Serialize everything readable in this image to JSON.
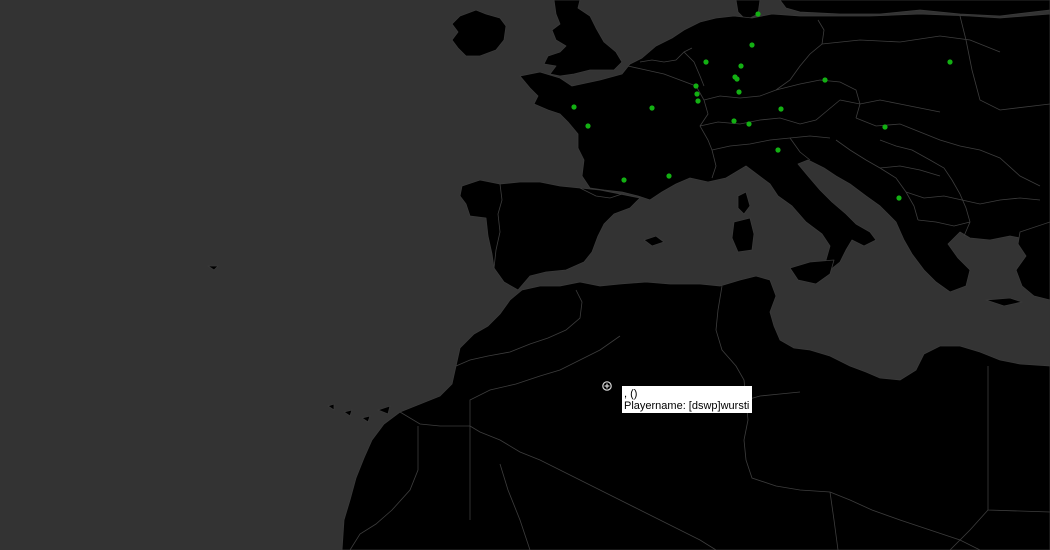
{
  "map": {
    "ocean_color": "#333333",
    "land_color": "#000000",
    "border_color": "#3d3d3d",
    "player_marker_color": "#13b013",
    "cursor": "crosshair-plus"
  },
  "tooltip": {
    "line1": ", ()",
    "line2": "Playername: [dswp]wursti"
  }
}
